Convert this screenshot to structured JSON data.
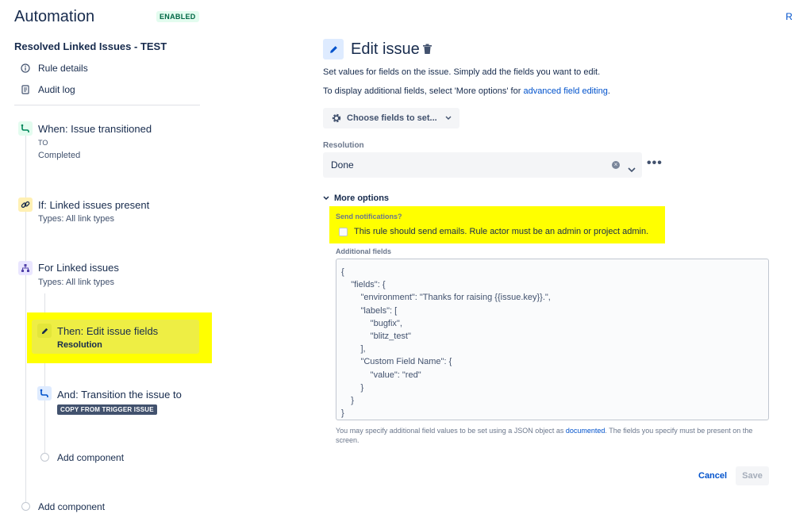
{
  "header": {
    "title": "Automation",
    "status_badge": "ENABLED",
    "top_right_link": "R"
  },
  "sidebar": {
    "rule_name": "Resolved Linked Issues - TEST",
    "items": [
      {
        "label": "Rule details",
        "icon": "info-icon"
      },
      {
        "label": "Audit log",
        "icon": "document-icon"
      }
    ],
    "components": [
      {
        "title": "When: Issue transitioned",
        "sub1": "TO",
        "sub2": "Completed",
        "icon": "transition-icon",
        "color": "#e3fcef"
      },
      {
        "title": "If: Linked issues present",
        "sub1": "Types: All link types",
        "icon": "link-icon",
        "color": "#fff0b3"
      },
      {
        "title": "For Linked issues",
        "sub1": "Types: All link types",
        "icon": "branch-icon",
        "color": "#eae6ff"
      },
      {
        "title": "Then: Edit issue fields",
        "sub1": "Resolution",
        "icon": "pencil-icon"
      },
      {
        "title": "And: Transition the issue to",
        "lozenge": "COPY FROM TRIGGER ISSUE",
        "icon": "transition-icon",
        "color": "#deebff"
      }
    ],
    "add_component_inner": "Add component",
    "add_component_outer": "Add component"
  },
  "panel": {
    "title": "Edit issue",
    "desc1": "Set values for fields on the issue. Simply add the fields you want to edit.",
    "desc2_prefix": "To display additional fields, select 'More options' for ",
    "desc2_link": "advanced field editing",
    "desc2_suffix": ".",
    "choose_fields_label": "Choose fields to set...",
    "resolution_label": "Resolution",
    "resolution_value": "Done",
    "more_options_label": "More options",
    "send_notifications_label": "Send notifications?",
    "send_notifications_checkbox": "This rule should send emails. Rule actor must be an admin or project admin.",
    "additional_fields_label": "Additional fields",
    "additional_fields_json": "{\n    \"fields\": {\n        \"environment\": \"Thanks for raising {{issue.key}}.\",\n        \"labels\": [\n            \"bugfix\",\n            \"blitz_test\"\n        ],\n        \"Custom Field Name\": {\n            \"value\": \"red\"\n        }\n    }\n}",
    "help_prefix": "You may specify additional field values to be set using a JSON object as ",
    "help_link": "documented",
    "help_suffix": ". The fields you specify must be present on the screen.",
    "cancel_label": "Cancel",
    "save_label": "Save"
  },
  "colors": {
    "highlight": "#ffff00",
    "link": "#0052cc",
    "enabled_badge": "#006644"
  }
}
